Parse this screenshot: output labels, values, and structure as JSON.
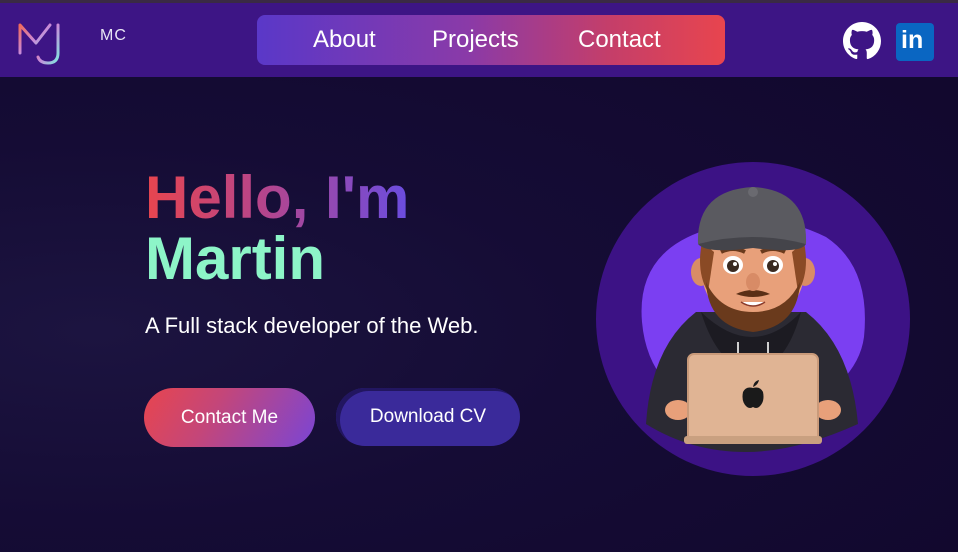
{
  "nav": {
    "brand": "MC",
    "links": [
      {
        "label": "About"
      },
      {
        "label": "Projects"
      },
      {
        "label": "Contact"
      }
    ],
    "social": [
      {
        "icon": "github-icon"
      },
      {
        "icon": "linkedin-icon",
        "label": "in"
      }
    ]
  },
  "hero": {
    "greeting": "Hello, I'm",
    "name": "Martin",
    "tagline": "A Full stack developer of the Web.",
    "buttons": {
      "contact": "Contact Me",
      "download": "Download CV"
    }
  },
  "colors": {
    "navbar": "#3d1585",
    "background": "#120a2e",
    "name": "#8df5c8",
    "accent_red": "#e8454e",
    "accent_purple": "#6a4de0",
    "avatar_ring": "#3c1285",
    "avatar_blob": "#7b3ff2"
  }
}
